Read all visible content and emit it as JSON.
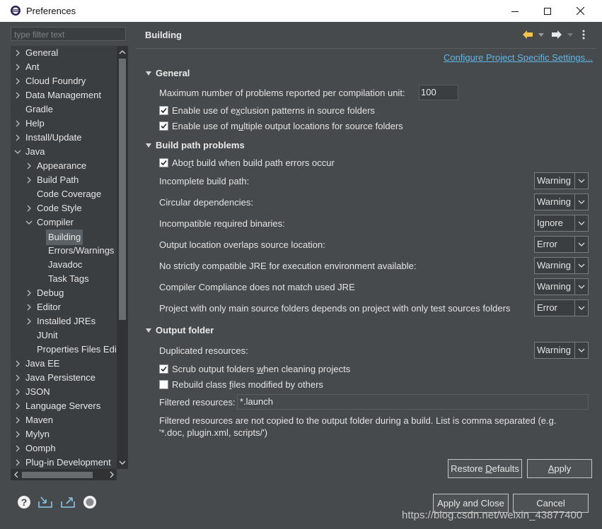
{
  "window": {
    "title": "Preferences"
  },
  "filter": {
    "placeholder": "type filter text"
  },
  "tree": [
    {
      "label": "General",
      "level": 0,
      "twisty": "right"
    },
    {
      "label": "Ant",
      "level": 0,
      "twisty": "right"
    },
    {
      "label": "Cloud Foundry",
      "level": 0,
      "twisty": "right"
    },
    {
      "label": "Data Management",
      "level": 0,
      "twisty": "right"
    },
    {
      "label": "Gradle",
      "level": 0,
      "twisty": "none"
    },
    {
      "label": "Help",
      "level": 0,
      "twisty": "right"
    },
    {
      "label": "Install/Update",
      "level": 0,
      "twisty": "right"
    },
    {
      "label": "Java",
      "level": 0,
      "twisty": "down"
    },
    {
      "label": "Appearance",
      "level": 1,
      "twisty": "right"
    },
    {
      "label": "Build Path",
      "level": 1,
      "twisty": "right"
    },
    {
      "label": "Code Coverage",
      "level": 1,
      "twisty": "none"
    },
    {
      "label": "Code Style",
      "level": 1,
      "twisty": "right"
    },
    {
      "label": "Compiler",
      "level": 1,
      "twisty": "down"
    },
    {
      "label": "Building",
      "level": 2,
      "twisty": "none",
      "selected": true
    },
    {
      "label": "Errors/Warnings",
      "level": 2,
      "twisty": "none"
    },
    {
      "label": "Javadoc",
      "level": 2,
      "twisty": "none"
    },
    {
      "label": "Task Tags",
      "level": 2,
      "twisty": "none"
    },
    {
      "label": "Debug",
      "level": 1,
      "twisty": "right"
    },
    {
      "label": "Editor",
      "level": 1,
      "twisty": "right"
    },
    {
      "label": "Installed JREs",
      "level": 1,
      "twisty": "right"
    },
    {
      "label": "JUnit",
      "level": 1,
      "twisty": "none"
    },
    {
      "label": "Properties Files Edi",
      "level": 1,
      "twisty": "none"
    },
    {
      "label": "Java EE",
      "level": 0,
      "twisty": "right"
    },
    {
      "label": "Java Persistence",
      "level": 0,
      "twisty": "right"
    },
    {
      "label": "JSON",
      "level": 0,
      "twisty": "right"
    },
    {
      "label": "Language Servers",
      "level": 0,
      "twisty": "right"
    },
    {
      "label": "Maven",
      "level": 0,
      "twisty": "right"
    },
    {
      "label": "Mylyn",
      "level": 0,
      "twisty": "right"
    },
    {
      "label": "Oomph",
      "level": 0,
      "twisty": "right"
    },
    {
      "label": "Plug-in Development",
      "level": 0,
      "twisty": "right"
    }
  ],
  "page": {
    "title": "Building",
    "configure_link": "Configure Project Specific Settings...",
    "general": {
      "title": "General",
      "max_problems_label": "Maximum number of problems reported per compilation unit:",
      "max_problems_value": "100",
      "exclusion_pre": "Enable use of e",
      "exclusion_u": "x",
      "exclusion_post": "clusion patterns in source folders",
      "multiple_pre": "Enable use of m",
      "multiple_u": "u",
      "multiple_post": "ltiple output locations for source folders"
    },
    "build_path": {
      "title": "Build path problems",
      "abort_pre": "Abo",
      "abort_u": "r",
      "abort_post": "t build when build path errors occur",
      "rows": [
        {
          "label": "Incomplete build path:",
          "value": "Warning"
        },
        {
          "label": "Circular dependencies:",
          "value": "Warning"
        },
        {
          "label": "Incompatible required binaries:",
          "value": "Ignore"
        },
        {
          "label": "Output location overlaps source location:",
          "value": "Error"
        },
        {
          "label": "No strictly compatible JRE for execution environment available:",
          "value": "Warning"
        },
        {
          "label": "Compiler Compliance does not match used JRE",
          "value": "Warning"
        },
        {
          "label": "Project with only main source folders depends on project with only test sources folders",
          "value": "Error"
        }
      ]
    },
    "output": {
      "title": "Output folder",
      "dup_label": "Duplicated resources:",
      "dup_value": "Warning",
      "scrub_pre": "Scrub output folders ",
      "scrub_u": "w",
      "scrub_post": "hen cleaning projects",
      "rebuild_pre": "Rebuild class ",
      "rebuild_u": "f",
      "rebuild_post": "iles modified by others",
      "filtered_label": "Filtered resources:",
      "filtered_value": "*.launch",
      "note_line1": "Filtered resources are not copied to the output folder during a build. List is comma separated (e.g.",
      "note_line2": "'*.doc, plugin.xml, scripts/')"
    },
    "restore_pre": "Restore ",
    "restore_u": "D",
    "restore_post": "efaults",
    "apply_u": "A",
    "apply_post": "pply"
  },
  "footer": {
    "apply_close": "Apply and Close",
    "cancel": "Cancel"
  },
  "watermark": "https://blog.csdn.net/weixin_43877400",
  "colors": {
    "background": "#474a4c",
    "link": "#5fb6e6",
    "selected": "#5a6166"
  }
}
